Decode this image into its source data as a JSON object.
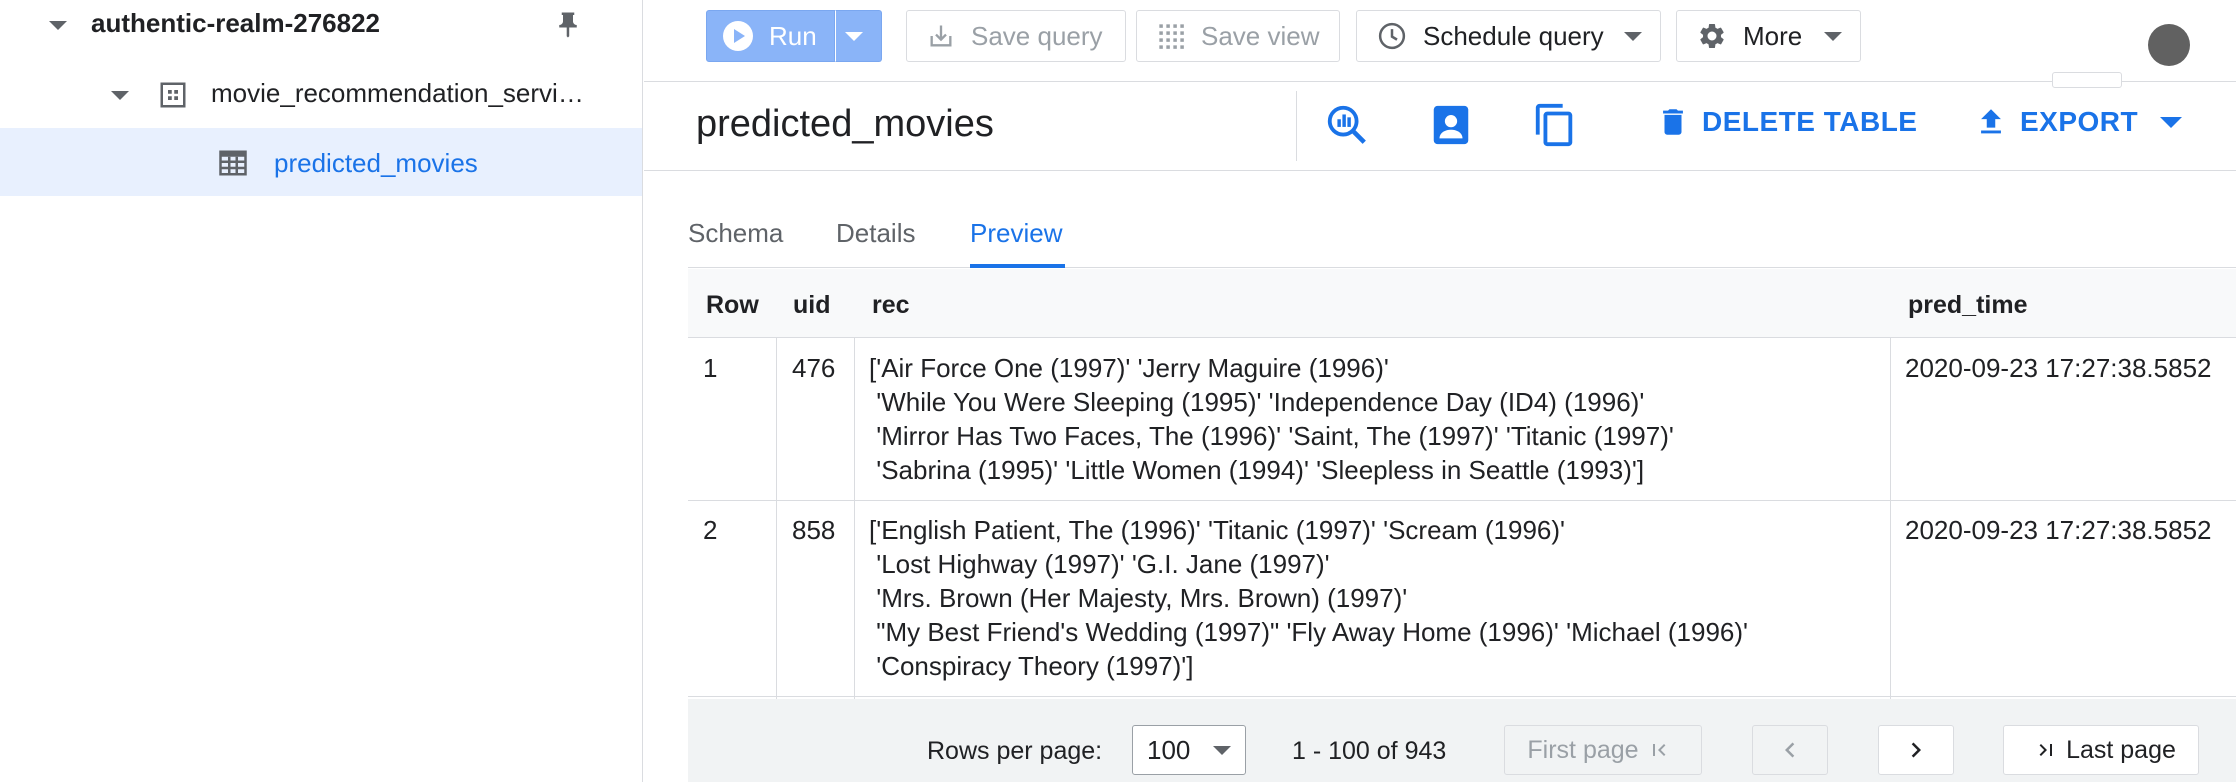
{
  "sidebar": {
    "project": "authentic-realm-276822",
    "dataset": "movie_recommendation_servi…",
    "table": "predicted_movies"
  },
  "toolbar": {
    "run_label": "Run",
    "save_query_label": "Save query",
    "save_view_label": "Save view",
    "schedule_label": "Schedule query",
    "more_label": "More"
  },
  "table_header": {
    "title": "predicted_movies",
    "delete_label": "DELETE TABLE",
    "export_label": "EXPORT"
  },
  "tabs": [
    "Schema",
    "Details",
    "Preview"
  ],
  "active_tab": "Preview",
  "grid": {
    "columns": [
      "Row",
      "uid",
      "rec",
      "pred_time"
    ],
    "rows": [
      {
        "row": "1",
        "uid": "476",
        "rec": "['Air Force One (1997)' 'Jerry Maguire (1996)'\n 'While You Were Sleeping (1995)' 'Independence Day (ID4) (1996)'\n 'Mirror Has Two Faces, The (1996)' 'Saint, The (1997)' 'Titanic (1997)'\n 'Sabrina (1995)' 'Little Women (1994)' 'Sleepless in Seattle (1993)']",
        "pred_time": "2020-09-23 17:27:38.5852"
      },
      {
        "row": "2",
        "uid": "858",
        "rec": "['English Patient, The (1996)' 'Titanic (1997)' 'Scream (1996)'\n 'Lost Highway (1997)' 'G.I. Jane (1997)'\n 'Mrs. Brown (Her Majesty, Mrs. Brown) (1997)'\n \"My Best Friend's Wedding (1997)\" 'Fly Away Home (1996)' 'Michael (1996)'\n 'Conspiracy Theory (1997)']",
        "pred_time": "2020-09-23 17:27:38.5852"
      }
    ]
  },
  "pagination": {
    "rows_per_page_label": "Rows per page:",
    "rows_per_page_value": "100",
    "range_label": "1 - 100 of 943",
    "first_page_label": "First page",
    "last_page_label": "Last page"
  },
  "colors": {
    "accent": "#1a73e8",
    "run_button": "#8ab4f8",
    "selected_row": "#e8f0fe"
  }
}
